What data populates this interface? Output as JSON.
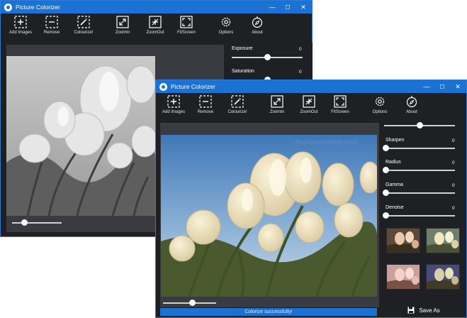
{
  "app_title": "Picture Colorizer",
  "window_controls": {
    "minimize": "—",
    "maximize": "☐",
    "close": "✕"
  },
  "toolbar": [
    {
      "id": "add-images",
      "label": "Add Images",
      "icon": "add-icon"
    },
    {
      "id": "remove",
      "label": "Remove",
      "icon": "remove-icon"
    },
    {
      "id": "colourize",
      "label": "Colourize!",
      "icon": "wand-icon"
    },
    {
      "id": "zoomin",
      "label": "ZoomIn",
      "icon": "zoom-in-icon"
    },
    {
      "id": "zoomout",
      "label": "ZoomOut",
      "icon": "zoom-out-icon"
    },
    {
      "id": "fitscreen",
      "label": "FitScreen",
      "icon": "fit-screen-icon"
    },
    {
      "id": "options",
      "label": "Options",
      "icon": "gear-icon"
    },
    {
      "id": "about",
      "label": "About",
      "icon": "compass-icon"
    }
  ],
  "back_window": {
    "adjustments": [
      {
        "label": "Exposure",
        "value": "0",
        "level": 0.5
      },
      {
        "label": "Saturation",
        "value": "0",
        "level": 0.5
      }
    ],
    "zoom_level": 0.25
  },
  "front_window": {
    "adjustments": [
      {
        "label": "",
        "value": "",
        "level": 0.5
      },
      {
        "label": "Sharpen",
        "value": "0",
        "level": 0.0
      },
      {
        "label": "Radius",
        "value": "0",
        "level": 0.0
      },
      {
        "label": "Gamma",
        "value": "0",
        "level": 0.0
      },
      {
        "label": "Denoise",
        "value": "0",
        "level": 0.0
      }
    ],
    "zoom_level": 0.55,
    "status_text": "Colorize successfully!",
    "save_label": "Save As",
    "watermark": "AccuweareBlog.com",
    "thumbnails": [
      "warm",
      "cool",
      "pink",
      "violet"
    ]
  },
  "colors": {
    "accent": "#1b72d2",
    "window_bg": "#1f2023",
    "panel_bg": "#3a3b40"
  }
}
